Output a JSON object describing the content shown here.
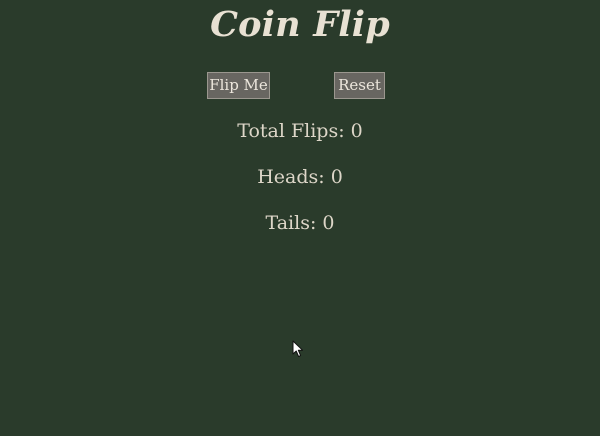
{
  "title": "Coin Flip",
  "buttons": {
    "flip_label": "Flip Me",
    "reset_label": "Reset"
  },
  "stats": {
    "total_label": "Total Flips: ",
    "total_value": "0",
    "heads_label": "Heads: ",
    "heads_value": "0",
    "tails_label": "Tails: ",
    "tails_value": "0"
  },
  "colors": {
    "background": "#2a3b2b",
    "text": "#ddd6c8",
    "button_bg": "#686661",
    "button_border": "#9b978f"
  },
  "icons": {
    "cursor": "mouse-pointer-icon"
  }
}
